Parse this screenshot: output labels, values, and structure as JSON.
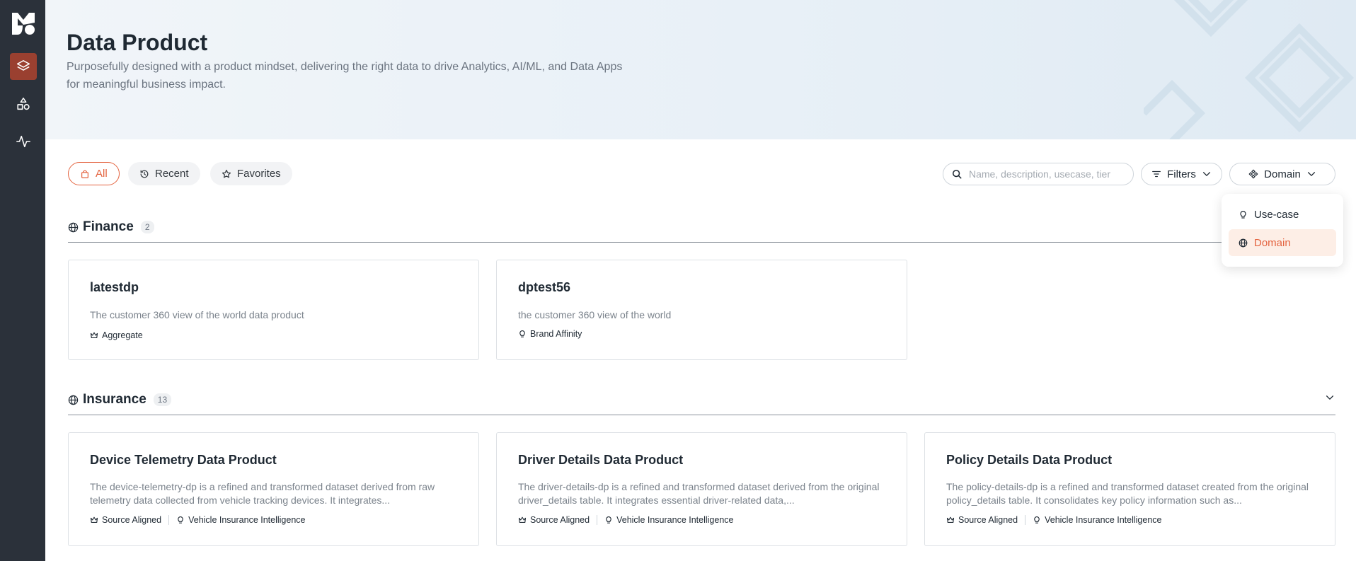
{
  "nav": {
    "logo": "logo",
    "items": [
      {
        "name": "data-products",
        "icon": "layers-icon",
        "active": true
      },
      {
        "name": "shapes",
        "icon": "shapes-icon",
        "active": false
      },
      {
        "name": "activity",
        "icon": "activity-icon",
        "active": false
      }
    ]
  },
  "header": {
    "title": "Data Product",
    "subtitle": "Purposefully designed with a product mindset, delivering the right data to drive Analytics, AI/ML, and Data Apps for meaningful business impact."
  },
  "tabs": [
    {
      "label": "All",
      "icon": "bag-icon"
    },
    {
      "label": "Recent",
      "icon": "history-icon"
    },
    {
      "label": "Favorites",
      "icon": "star-icon"
    }
  ],
  "search": {
    "placeholder": "Name, description, usecase, tier"
  },
  "filters_label": "Filters",
  "group_by_label": "Domain",
  "dropdown": {
    "options": [
      {
        "label": "Use-case",
        "icon": "bulb-icon",
        "selected": false
      },
      {
        "label": "Domain",
        "icon": "globe-icon",
        "selected": true
      }
    ]
  },
  "groups": [
    {
      "name": "Finance",
      "count": "2",
      "cards": [
        {
          "title": "latestdp",
          "description": "The customer 360 view of the world data product",
          "tags": [
            {
              "icon": "crown-icon",
              "label": "Aggregate"
            }
          ]
        },
        {
          "title": "dptest56",
          "description": "the customer 360 view of the world",
          "tags": [
            {
              "icon": "bulb-icon",
              "label": "Brand Affinity"
            }
          ]
        }
      ]
    },
    {
      "name": "Insurance",
      "count": "13",
      "cards": [
        {
          "title": "Device Telemetry Data Product",
          "description": "The device-telemetry-dp is a refined and transformed dataset derived from raw telemetry data collected from vehicle tracking devices. It integrates...",
          "tags": [
            {
              "icon": "crown-icon",
              "label": "Source Aligned"
            },
            {
              "icon": "bulb-icon",
              "label": "Vehicle Insurance Intelligence"
            }
          ]
        },
        {
          "title": "Driver Details Data Product",
          "description": "The driver-details-dp is a refined and transformed dataset derived from the original driver_details table. It integrates essential driver-related data,...",
          "tags": [
            {
              "icon": "crown-icon",
              "label": "Source Aligned"
            },
            {
              "icon": "bulb-icon",
              "label": "Vehicle Insurance Intelligence"
            }
          ]
        },
        {
          "title": "Policy Details Data Product",
          "description": "The policy-details-dp is a refined and transformed dataset created from the original policy_details table. It consolidates key policy information such as...",
          "tags": [
            {
              "icon": "crown-icon",
              "label": "Source Aligned"
            },
            {
              "icon": "bulb-icon",
              "label": "Vehicle Insurance Intelligence"
            }
          ]
        }
      ]
    }
  ],
  "colors": {
    "accent": "#e4633f",
    "sidebar": "#2b313a",
    "nav_active": "#9a4030"
  }
}
